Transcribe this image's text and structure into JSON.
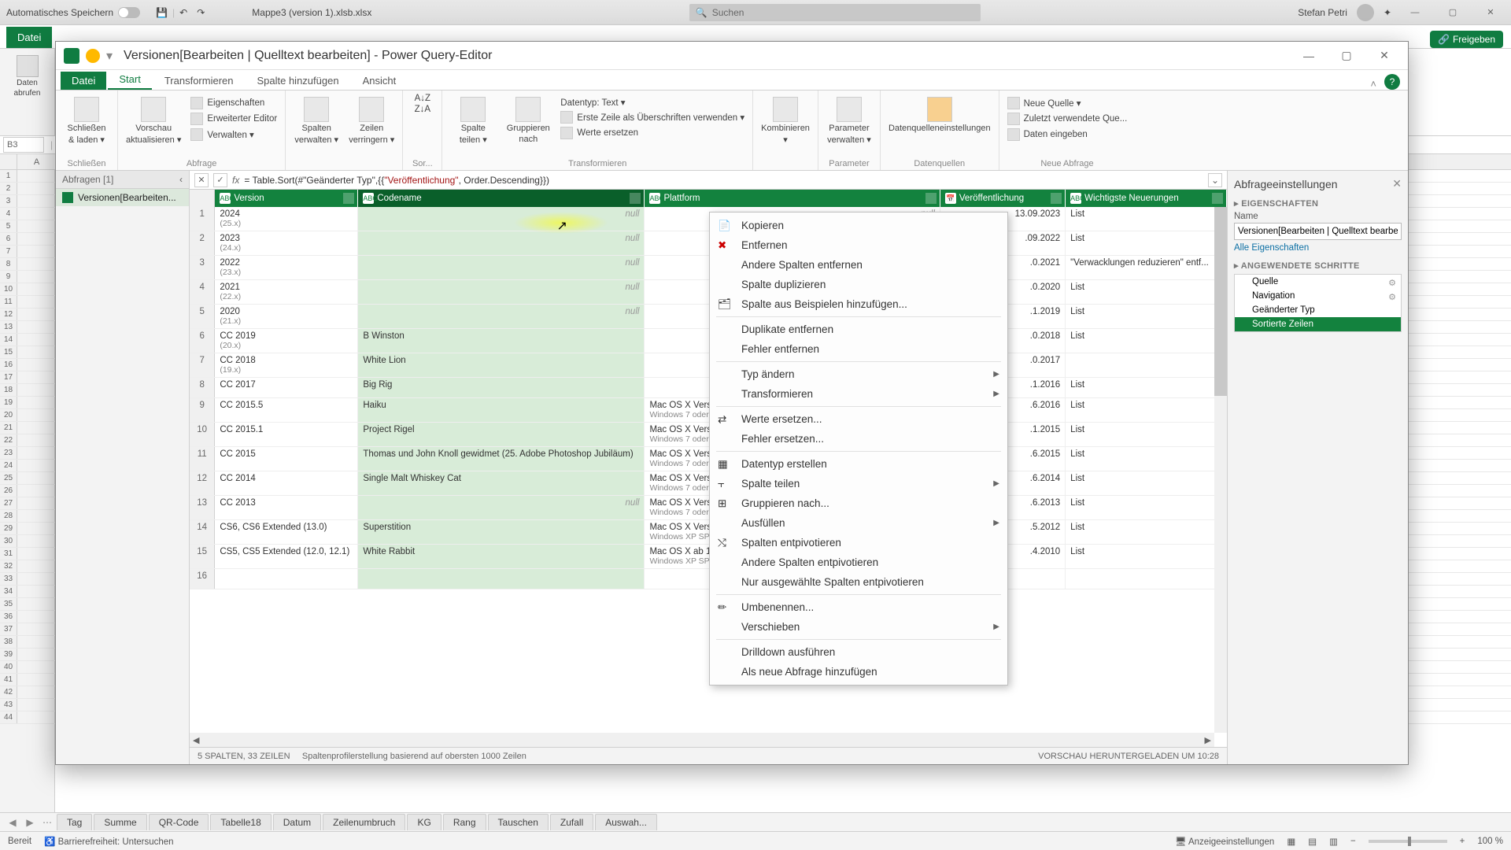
{
  "excel_titlebar": {
    "autosave_label": "Automatisches Speichern",
    "filename": "Mappe3 (version 1).xlsb.xlsx",
    "search_placeholder": "Suchen",
    "username": "Stefan Petri"
  },
  "excel_tabs": {
    "file": "Datei",
    "share": "Freigeben"
  },
  "excel_left": {
    "btn1_l1": "Daten",
    "btn1_l2": "abrufen"
  },
  "excel_name_box": "B3",
  "pq": {
    "title": "Versionen[Bearbeiten | Quelltext bearbeiten] - Power Query-Editor",
    "tabs": {
      "file": "Datei",
      "start": "Start",
      "transform": "Transformieren",
      "addcol": "Spalte hinzufügen",
      "view": "Ansicht"
    },
    "ribbon": {
      "close_load_l1": "Schließen",
      "close_load_l2": "& laden",
      "close_group": "Schließen",
      "refresh_l1": "Vorschau",
      "refresh_l2": "aktualisieren",
      "props": "Eigenschaften",
      "adved": "Erweiterter Editor",
      "manage": "Verwalten",
      "query_group": "Abfrage",
      "cols_l1": "Spalten",
      "cols_l2": "verwalten",
      "rows_l1": "Zeilen",
      "rows_l2": "verringern",
      "sort_group": "Sor...",
      "splitcol_l1": "Spalte",
      "splitcol_l2": "teilen",
      "groupby_l1": "Gruppieren",
      "groupby_l2": "nach",
      "datatype": "Datentyp: Text",
      "firstrow": "Erste Zeile als Überschriften verwenden",
      "replace": "Werte ersetzen",
      "transform_group": "Transformieren",
      "combine": "Kombinieren",
      "params_l1": "Parameter",
      "params_l2": "verwalten",
      "params_group": "Parameter",
      "ds_settings": "Datenquelleneinstellungen",
      "ds_group": "Datenquellen",
      "newsrc": "Neue Quelle",
      "recentsrc": "Zuletzt verwendete Que...",
      "enterdata": "Daten eingeben",
      "newquery_group": "Neue Abfrage"
    },
    "queries": {
      "header": "Abfragen [1]",
      "item": "Versionen[Bearbeiten..."
    },
    "formula_prefix": "= Table.Sort(#\"Geänderter Typ\",{{",
    "formula_str": "\"Veröffentlichung\"",
    "formula_suffix": ", Order.Descending}})",
    "cols": {
      "version": "Version",
      "codename": "Codename",
      "platform": "Plattform",
      "release": "Veröffentlichung",
      "news": "Wichtigste Neuerungen"
    },
    "rows": [
      {
        "n": "1",
        "ver": "2024",
        "vsub": "(25.x)",
        "code": "null",
        "plat": "null",
        "rel": "13.09.2023",
        "news": "List"
      },
      {
        "n": "2",
        "ver": "2023",
        "vsub": "(24.x)",
        "code": "null",
        "plat": "",
        "rel": ".09.2022",
        "news": "List"
      },
      {
        "n": "3",
        "ver": "2022",
        "vsub": "(23.x)",
        "code": "null",
        "plat": "",
        "rel": ".0.2021",
        "news": "\"Verwacklungen reduzieren\" entf..."
      },
      {
        "n": "4",
        "ver": "2021",
        "vsub": "(22.x)",
        "code": "null",
        "plat": "",
        "rel": ".0.2020",
        "news": "List"
      },
      {
        "n": "5",
        "ver": "2020",
        "vsub": "(21.x)",
        "code": "null",
        "plat": "",
        "rel": ".1.2019",
        "news": "List"
      },
      {
        "n": "6",
        "ver": "CC 2019",
        "vsub": "(20.x)",
        "code": "B Winston",
        "plat": "",
        "rel": ".0.2018",
        "news": "List"
      },
      {
        "n": "7",
        "ver": "CC 2018",
        "vsub": "(19.x)",
        "code": "White Lion",
        "plat": "",
        "rel": ".0.2017",
        "news": ""
      },
      {
        "n": "8",
        "ver": "CC 2017",
        "vsub": "",
        "code": "Big Rig",
        "plat": "",
        "rel": ".1.2016",
        "news": "List"
      },
      {
        "n": "9",
        "ver": "CC 2015.5",
        "vsub": "",
        "code": "Haiku",
        "plat": "Mac OS X Version ...",
        "plat2": "Windows 7 oder ...",
        "rel": ".6.2016",
        "news": "List"
      },
      {
        "n": "10",
        "ver": "CC 2015.1",
        "vsub": "",
        "code": "Project Rigel",
        "plat": "Mac OS X Version ...",
        "plat2": "Windows 7 oder ...",
        "rel": ".1.2015",
        "news": "List"
      },
      {
        "n": "11",
        "ver": "CC 2015",
        "vsub": "",
        "code": "Thomas und John Knoll gewidmet (25. Adobe Photoshop Jubiläum)",
        "plat": "Mac OS X Version ...",
        "plat2": "Windows 7 oder ...",
        "rel": ".6.2015",
        "news": "List"
      },
      {
        "n": "12",
        "ver": "CC 2014",
        "vsub": "",
        "code": "Single Malt Whiskey Cat",
        "plat": "Mac OS X Version ...",
        "plat2": "Windows 7 oder ...",
        "rel": ".6.2014",
        "news": "List"
      },
      {
        "n": "13",
        "ver": "CC 2013",
        "vsub": "",
        "code": "null",
        "plat": "Mac OS X Version ...",
        "plat2": "Windows 7 oder ...",
        "rel": ".6.2013",
        "news": "List"
      },
      {
        "n": "14",
        "ver": "CS6, CS6 Extended (13.0)",
        "vsub": "",
        "code": "Superstition",
        "plat": "Mac OS X Version ...",
        "plat2": "Windows XP SP3 ...",
        "rel": ".5.2012",
        "news": "List"
      },
      {
        "n": "15",
        "ver": "CS5, CS5 Extended (12.0, 12.1)",
        "vsub": "",
        "code": "White Rabbit",
        "plat": "Mac OS X ab 10.5...",
        "plat2": "Windows XP SP3 ...",
        "rel": ".4.2010",
        "news": "List"
      },
      {
        "n": "16",
        "ver": "",
        "vsub": "",
        "code": "",
        "plat": "",
        "rel": "",
        "news": ""
      }
    ],
    "status_left1": "5 SPALTEN, 33 ZEILEN",
    "status_left2": "Spaltenprofilerstellung basierend auf obersten 1000 Zeilen",
    "status_right": "VORSCHAU HERUNTERGELADEN UM 10:28",
    "settings": {
      "title": "Abfrageeinstellungen",
      "props_label": "EIGENSCHAFTEN",
      "name_label": "Name",
      "name_value": "Versionen[Bearbeiten | Quelltext bearbeit",
      "all_props": "Alle Eigenschaften",
      "steps_label": "ANGEWENDETE SCHRITTE",
      "steps": [
        "Quelle",
        "Navigation",
        "Geänderter Typ",
        "Sortierte Zeilen"
      ]
    },
    "ctx": {
      "copy": "Kopieren",
      "remove": "Entfernen",
      "remove_others": "Andere Spalten entfernen",
      "dup": "Spalte duplizieren",
      "from_examples": "Spalte aus Beispielen hinzufügen...",
      "rem_dup": "Duplikate entfernen",
      "rem_err": "Fehler entfernen",
      "chtype": "Typ ändern",
      "transform": "Transformieren",
      "replace_vals": "Werte ersetzen...",
      "replace_err": "Fehler ersetzen...",
      "create_type": "Datentyp erstellen",
      "split": "Spalte teilen",
      "groupby": "Gruppieren nach...",
      "fill": "Ausfüllen",
      "unpivot": "Spalten entpivotieren",
      "unpivot_others": "Andere Spalten entpivotieren",
      "unpivot_sel": "Nur ausgewählte Spalten entpivotieren",
      "rename": "Umbenennen...",
      "move": "Verschieben",
      "drill": "Drilldown ausführen",
      "as_new": "Als neue Abfrage hinzufügen"
    }
  },
  "sheets": [
    "Tag",
    "Summe",
    "QR-Code",
    "Tabelle18",
    "Datum",
    "Zeilenumbruch",
    "KG",
    "Rang",
    "Tauschen",
    "Zufall",
    "Auswah..."
  ],
  "statusbar": {
    "ready": "Bereit",
    "access": "Barrierefreiheit: Untersuchen",
    "display_settings": "Anzeigeeinstellungen",
    "zoom": "100 %"
  }
}
